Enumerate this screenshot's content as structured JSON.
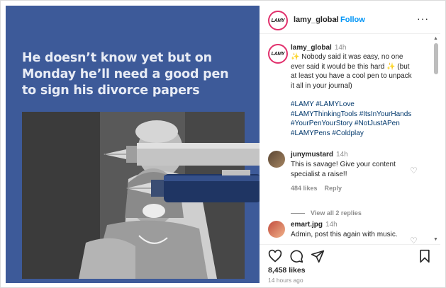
{
  "post_image": {
    "headline": "He doesn’t know yet but on Monday he’ll need a good pen to sign his divorce papers"
  },
  "header": {
    "avatar_text": "LAMY",
    "username": "lamy_global",
    "separator": "•",
    "follow_label": "Follow",
    "more_icon": "···"
  },
  "caption": {
    "avatar_text": "LAMY",
    "username": "lamy_global",
    "time": "14h",
    "lines": [
      "✨ Nobody said it was easy, no one",
      "ever said it would be this hard ✨ (but",
      "at least you have a cool pen to unpack",
      "it all in your journal)"
    ],
    "hashtags": [
      "#LAMY #LAMYLove",
      "#LAMYThinkingTools #ItsInYourHands",
      "#YourPenYourStory #NotJustAPen",
      "#LAMYPens #Coldplay"
    ]
  },
  "comments": [
    {
      "username": "junymustard",
      "time": "14h",
      "lines": [
        "This is savage! Give your content",
        "specialist a raise!!"
      ],
      "likes": "484 likes",
      "reply_label": "Reply",
      "view_replies": "View all 2 replies"
    },
    {
      "username": "emart.jpg",
      "time": "14h",
      "lines": [
        "Admin, post this again with music."
      ]
    }
  ],
  "actions": {
    "likes_count": "8,458 likes",
    "time_ago": "14 hours ago"
  },
  "colors": {
    "media_background": "#3d5a99",
    "link": "#0095f6",
    "hashtag": "#00376b",
    "avatar_ring": "#e1306c"
  }
}
